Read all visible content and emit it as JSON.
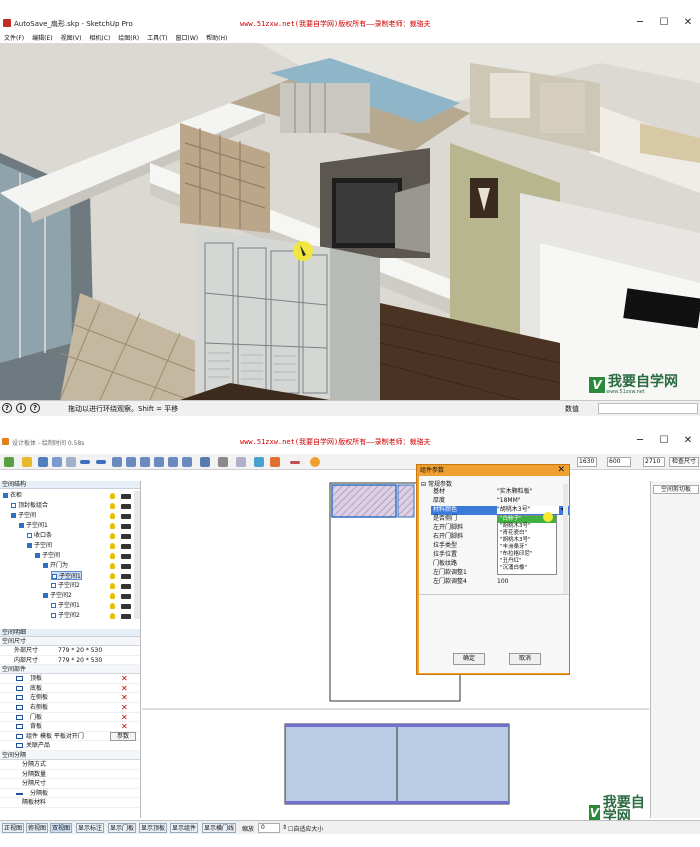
{
  "top": {
    "title": "AutoSave_扇形.skp - SketchUp Pro",
    "watermark": "www.51zxw.net(我要自学网)版权所有——录制老师：裁骆夫",
    "menus": [
      "文件(F)",
      "编辑(E)",
      "视图(V)",
      "相机(C)",
      "绘图(R)",
      "工具(T)",
      "窗口(W)",
      "帮助(H)"
    ],
    "status_text": "拖动以进行环绕观察。Shift = 平移",
    "measure_label": "数值",
    "status_icons": [
      "?",
      "i",
      "?"
    ]
  },
  "bottom": {
    "title": "设计板体 - 绘制时间 0.58s",
    "watermark": "www.51zxw.net(我要自学网)版权所有——录制老师：裁骆夫",
    "size_w": "1630",
    "size_d": "600",
    "size_h": "2710",
    "right_button": "检查尺寸",
    "right_tab": "空间剪切板",
    "structure_header": "空间结构",
    "tree": [
      {
        "label": "衣柜",
        "d": 0
      },
      {
        "label": "顶封板组合",
        "d": 1
      },
      {
        "label": "子空间",
        "d": 1
      },
      {
        "label": "子空间1",
        "d": 2
      },
      {
        "label": "收口条",
        "d": 3
      },
      {
        "label": "子空间",
        "d": 3
      },
      {
        "label": "子空间",
        "d": 4
      },
      {
        "label": "开门为",
        "d": 5
      },
      {
        "label": "子空间1",
        "d": 6
      },
      {
        "label": "子空间2",
        "d": 6
      },
      {
        "label": "子空间2",
        "d": 5
      },
      {
        "label": "子空间1",
        "d": 6
      },
      {
        "label": "子空间2",
        "d": 6
      }
    ],
    "props_header": "空间明细",
    "props": {
      "sec_size": "空间尺寸",
      "outer_label": "外部尺寸",
      "outer_value": "779 * 20 * 530",
      "inner_label": "内部尺寸",
      "inner_value": "779 * 20 * 530",
      "sec_parts": "空间部件",
      "parts": [
        "顶板",
        "底板",
        "左侧板",
        "右侧板",
        "门板",
        "背板"
      ],
      "combo_label": "组件",
      "combo_value": "模板 平板对开门",
      "combo_button": "参数",
      "related": "关联产品",
      "sec_split": "空间分隔",
      "split_rows": [
        "分隔方式",
        "分隔数量",
        "分隔尺寸",
        "分隔板",
        "隔板材料"
      ]
    },
    "status_buttons": [
      "正视图",
      "俯视图",
      "双视图",
      "显示标注",
      "显示门板",
      "显示顶板",
      "显示组件",
      "显示横门线"
    ],
    "zoom_label": "缩放",
    "zoom_value": "0",
    "autofit": "自适应大小"
  },
  "dialog": {
    "title": "组件参数",
    "section": "常规参数",
    "rows": [
      {
        "k": "基材",
        "v": "\"实木颗粒板\""
      },
      {
        "k": "厚度",
        "v": "\"18MM\""
      },
      {
        "k": "材料颜色",
        "v": "\"胡桃木3号\""
      },
      {
        "k": "是否侧门",
        "v": ""
      },
      {
        "k": "左开门脚斜",
        "v": ""
      },
      {
        "k": "右开门脚斜",
        "v": ""
      },
      {
        "k": "拉手类型",
        "v": ""
      },
      {
        "k": "拉手位置",
        "v": ""
      },
      {
        "k": "门板纹路",
        "v": ""
      },
      {
        "k": "左门款调整1",
        "v": "100"
      },
      {
        "k": "左门款调整4",
        "v": "100"
      }
    ],
    "options": [
      "\"白柿子\"",
      "\"胡桃木3号\"",
      "\"青花瓷白\"",
      "\"胡桃木3号\"",
      "\"丰洲桑牙\"",
      "\"布拉格印尼\"",
      "\"丑丹红\"",
      "\"沉涌白橡\"",
      "\"王龙蛋\""
    ],
    "ok": "确定",
    "cancel": "取消"
  },
  "logo": {
    "mark": "V",
    "text": "我要自学网",
    "url": "www.51zxw.net"
  },
  "colors": {
    "accent": "#f0a030",
    "selection": "#3070c0",
    "watermark": "#d00000"
  }
}
